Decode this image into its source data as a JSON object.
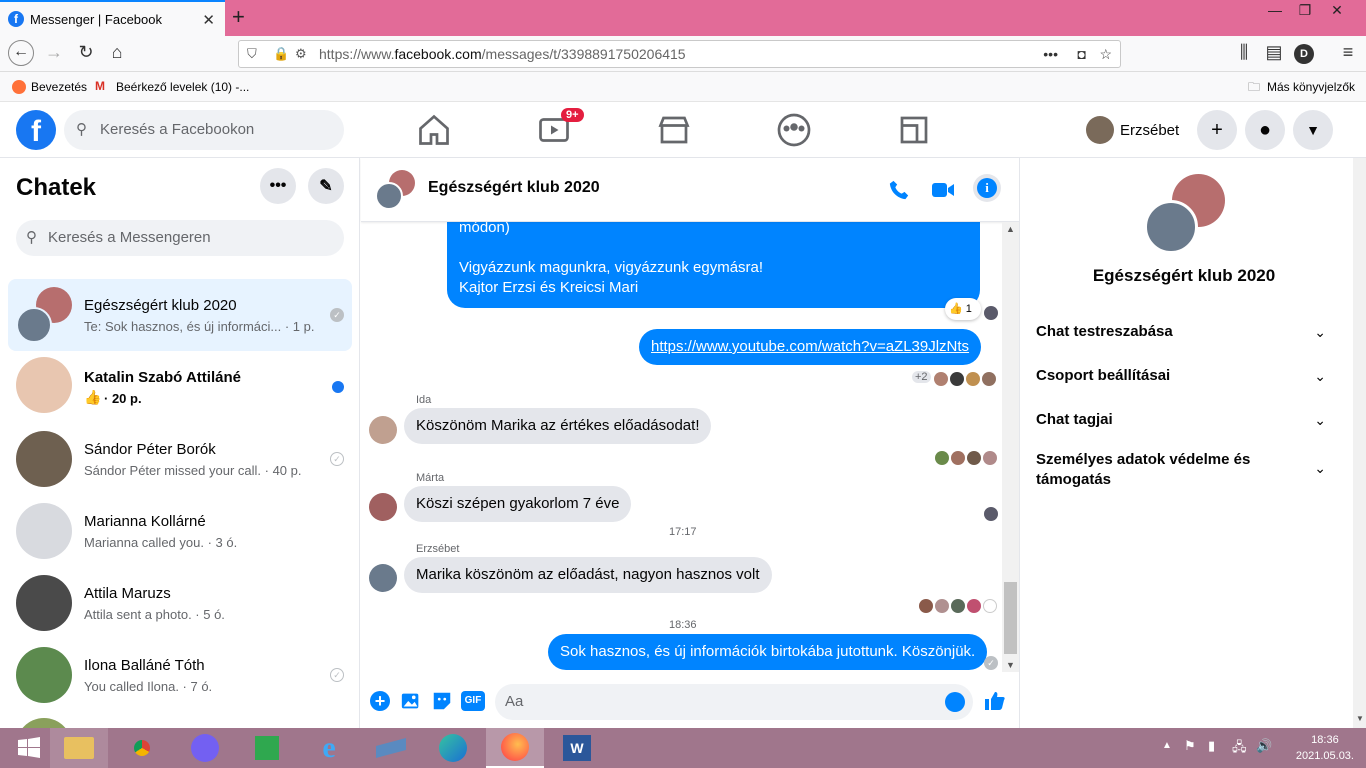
{
  "browser": {
    "tab_title": "Messenger | Facebook",
    "url_prefix": "https://www.",
    "url_domain": "facebook.com",
    "url_path": "/messages/t/3398891750206415",
    "bookmarks": [
      "Bevezetés",
      "Beérkező levelek (10) -..."
    ],
    "other_bookmarks": "Más könyvjelzők",
    "profile_letter": "D"
  },
  "fb": {
    "search_placeholder": "Keresés a Facebookon",
    "watch_badge": "9+",
    "user_name": "Erzsébet"
  },
  "left": {
    "title": "Chatek",
    "search_placeholder": "Keresés a Messengeren",
    "conversations": [
      {
        "name": "Egészségért klub 2020",
        "sub": "Te: Sok hasznos, és új informáci... · 1 p."
      },
      {
        "name": "Katalin Szabó Attiláné",
        "sub": "· 20 p."
      },
      {
        "name": "Sándor Péter Borók",
        "sub": "Sándor Péter missed your call. · 40 p."
      },
      {
        "name": "Marianna Kollárné",
        "sub": "Marianna called you. · 3 ó."
      },
      {
        "name": "Attila Maruzs",
        "sub": "Attila sent a photo. · 5 ó."
      },
      {
        "name": "Ilona Balláné Tóth",
        "sub": "You called Ilona. · 7 ó."
      }
    ]
  },
  "chat": {
    "title": "Egészségért klub 2020",
    "msg_partial_line1": "módon)",
    "msg_partial_line2": "Vigyázzunk magunkra, vigyázzunk egymásra!",
    "msg_partial_line3": "Kajtor Erzsi és Kreicsi Mari",
    "reaction_count": "1",
    "link": "https://www.youtube.com/watch?v=aZL39JlzNts",
    "seen_more": "+2",
    "sender1": "Ida",
    "msg1": "Köszönöm Marika az értékes előadásodat!",
    "sender2": "Márta",
    "msg2": "Köszi szépen gyakorlom  7 éve",
    "time1": "17:17",
    "sender3": "Erzsébet",
    "msg3": "Marika köszönöm az előadást, nagyon hasznos   volt",
    "time2": "18:36",
    "msg4": "Sok hasznos, és új információk birtokába jutottunk. Köszönjük.",
    "composer_placeholder": "Aa"
  },
  "right": {
    "title": "Egészségért klub 2020",
    "options": [
      "Chat testreszabása",
      "Csoport beállításai",
      "Chat tagjai",
      "Személyes adatok védelme és támogatás"
    ]
  },
  "taskbar": {
    "time": "18:36",
    "date": "2021.05.03."
  }
}
